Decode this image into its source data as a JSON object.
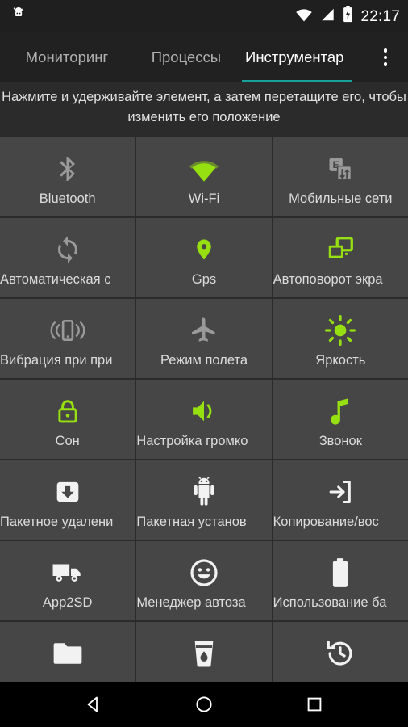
{
  "status_bar": {
    "app_icon": "android-head-icon",
    "wifi_icon": "wifi-icon",
    "signal_icon": "cell-signal-icon",
    "battery_icon": "battery-charging-icon",
    "time": "22:17"
  },
  "app_bar": {
    "tabs": [
      {
        "label": "Мониторинг",
        "active": false
      },
      {
        "label": "Процессы",
        "active": false
      },
      {
        "label": "Инструментар",
        "active": true
      }
    ],
    "overflow_label": "overflow-menu",
    "accent_color": "#17a39b"
  },
  "hint": {
    "text": "Нажмите и удерживайте элемент, а затем перетащите его, чтобы изменить его положение"
  },
  "colors": {
    "accent_green": "#96e011",
    "tile_bg": "#464646",
    "page_bg": "#2b2b2b",
    "icon_off": "#9a9a9a",
    "icon_white": "#f2f2f2",
    "label": "#dcdcdc"
  },
  "grid": {
    "tiles": [
      {
        "label": "Bluetooth",
        "icon": "bluetooth-icon",
        "state": "off",
        "clip": "none"
      },
      {
        "label": "Wi-Fi",
        "icon": "wifi-icon",
        "state": "on",
        "clip": "none"
      },
      {
        "label": "Мобильные сети",
        "icon": "mobile-data-icon",
        "state": "off",
        "clip": "none"
      },
      {
        "label": "Автоматическая с",
        "icon": "sync-icon",
        "state": "off",
        "clip": "left"
      },
      {
        "label": "Gps",
        "icon": "location-pin-icon",
        "state": "on",
        "clip": "none"
      },
      {
        "label": "Автоповорот экра",
        "icon": "auto-rotate-icon",
        "state": "on",
        "clip": "left"
      },
      {
        "label": "Вибрация при при",
        "icon": "vibration-icon",
        "state": "off",
        "clip": "left"
      },
      {
        "label": "Режим полета",
        "icon": "airplane-icon",
        "state": "off",
        "clip": "none"
      },
      {
        "label": "Яркость",
        "icon": "brightness-icon",
        "state": "on",
        "clip": "none"
      },
      {
        "label": "Сон",
        "icon": "lock-icon",
        "state": "on",
        "clip": "none"
      },
      {
        "label": "Настройка громко",
        "icon": "volume-icon",
        "state": "on",
        "clip": "left"
      },
      {
        "label": "Звонок",
        "icon": "music-note-icon",
        "state": "on",
        "clip": "none"
      },
      {
        "label": "Пакетное удалени",
        "icon": "package-uninstall-icon",
        "state": "white",
        "clip": "left"
      },
      {
        "label": "Пакетная установ",
        "icon": "android-robot-icon",
        "state": "white",
        "clip": "left"
      },
      {
        "label": "Копирование/вос",
        "icon": "backup-restore-icon",
        "state": "white",
        "clip": "left"
      },
      {
        "label": "App2SD",
        "icon": "truck-icon",
        "state": "white",
        "clip": "none"
      },
      {
        "label": "Менеджер автоза",
        "icon": "smiley-icon",
        "state": "white",
        "clip": "left"
      },
      {
        "label": "Использование ба",
        "icon": "battery-icon",
        "state": "white",
        "clip": "left"
      },
      {
        "label": "",
        "icon": "folder-icon",
        "state": "white",
        "clip": "none"
      },
      {
        "label": "",
        "icon": "cup-drop-icon",
        "state": "white",
        "clip": "none"
      },
      {
        "label": "",
        "icon": "history-icon",
        "state": "white",
        "clip": "none"
      }
    ]
  },
  "nav_bar": {
    "back_label": "back-button",
    "home_label": "home-button",
    "recents_label": "recents-button"
  }
}
